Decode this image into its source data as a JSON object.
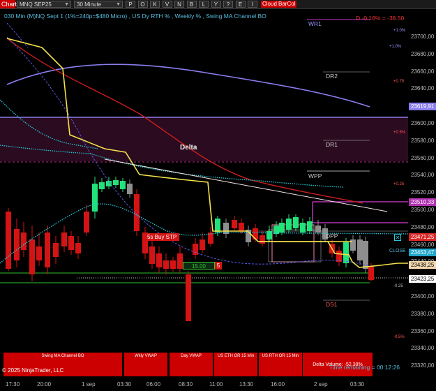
{
  "toolbar": {
    "chart_label": "Chart",
    "instrument": "MNQ SEP25",
    "interval": "30 Minute",
    "buttons": [
      "P",
      "O",
      "K",
      "V",
      "N",
      "B",
      "L",
      "Y",
      "?",
      "E",
      "I"
    ],
    "cloud_label": "Cloud",
    "barcol_label": "BarCol"
  },
  "indicator_text": "030 Min (M)NQ Sept 1  (1%=240p=$480 Micro) , US Dy RTH % , Weekly % , Swing MA Channel BO",
  "delta_change": "D -0.16% = -38.50",
  "chart_title": "Delta",
  "levels": {
    "wr1": "WR1",
    "dr2": "DR2",
    "dr1": "DR1",
    "wpp": "WPP",
    "dpp": "DPP",
    "close": "CLOSE",
    "ds1": "DS1"
  },
  "percent_labels": [
    "+1.0%",
    "+1.0%",
    "+0.75",
    "+0.5%",
    "+0.25",
    "-0.25",
    "-0.5%"
  ],
  "markers": {
    "buy_stop": "5s  Buy STP",
    "qty": "15.00",
    "qty_count": "5"
  },
  "price_axis": {
    "ticks": [
      "23700,00",
      "23680,00",
      "23660,00",
      "23640,00",
      "23620,00",
      "23600,00",
      "23580,00",
      "23560,00",
      "23540,00",
      "23520,00",
      "23500,00",
      "23480,00",
      "23460,00",
      "23440,00",
      "23420,00",
      "23400,00",
      "23380,00",
      "23360,00",
      "23340,00",
      "23320,00"
    ],
    "tags": [
      {
        "text": "23619,91",
        "bg": "#8a7ef0",
        "fg": "#fff"
      },
      {
        "text": "23510,33",
        "bg": "#b232b2",
        "fg": "#fff"
      },
      {
        "text": "23471,25",
        "bg": "#d92626",
        "fg": "#fff"
      },
      {
        "text": "23453,47",
        "bg": "#1fa6c9",
        "fg": "#fff"
      },
      {
        "text": "23438,25",
        "bg": "#f5d9b0",
        "fg": "#000"
      },
      {
        "text": "23423,25",
        "bg": "#ffffff",
        "fg": "#000"
      }
    ]
  },
  "time_axis": [
    "17:30",
    "20:00",
    "1 sep",
    "03:30",
    "06:00",
    "08:30",
    "11:00",
    "13:30",
    "16:00",
    "2 sep",
    "03:30"
  ],
  "bottom_panels": [
    {
      "label": "Swing MA Channel BO"
    },
    {
      "label": "Wkly VWAP"
    },
    {
      "label": "Day VWAP"
    },
    {
      "label": "US ETH OR 15 Min"
    },
    {
      "label": "US RTH OR 15 Min"
    },
    {
      "label": "Delta Volume: -52.38%"
    }
  ],
  "copyright": "© 2025 NinjaTrader, LLC",
  "time_remaining": "Time remaining = 00:12:26",
  "colors": {
    "background": "#000000",
    "bull": "#22e27a",
    "bear": "#d41414",
    "neutral": "#8e8e8e",
    "swing_ma": "#f2e14a",
    "vwap_weekly": "#8a7ef0",
    "ema_red": "#cc1d1d",
    "ma_cyan": "#27c6d6"
  }
}
